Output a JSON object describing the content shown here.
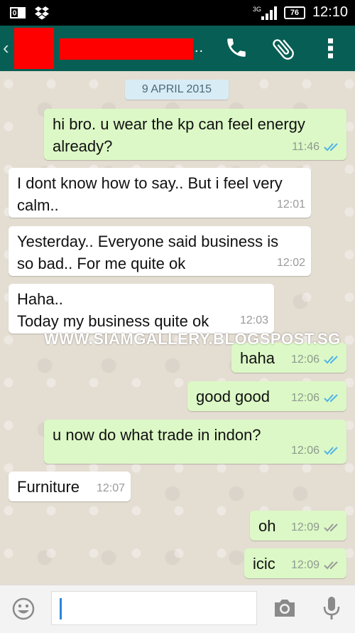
{
  "status_bar": {
    "time": "12:10",
    "battery": "76",
    "network": "3G",
    "left_icons": [
      "outlook-icon",
      "dropbox-icon"
    ]
  },
  "app_bar": {
    "icons": [
      "back-arrow-icon",
      "phone-icon",
      "paperclip-icon",
      "more-vert-icon"
    ],
    "ellipsis": "..",
    "brand_color": "#075e54"
  },
  "chat": {
    "date": "9 APRIL 2015",
    "messages": [
      {
        "dir": "out",
        "text": "hi bro. u wear the kp can feel energy\nalready?",
        "time": "11:46",
        "status": "read"
      },
      {
        "dir": "in",
        "text": "I dont know how to say.. But i feel very\ncalm..",
        "time": "12:01"
      },
      {
        "dir": "in",
        "text": "Yesterday.. Everyone said business is\nso bad.. For me quite ok",
        "time": "12:02"
      },
      {
        "dir": "in",
        "text": "Haha..\nToday my business quite ok",
        "time": "12:03"
      },
      {
        "dir": "out",
        "text": "haha",
        "time": "12:06",
        "status": "read"
      },
      {
        "dir": "out",
        "text": "good good",
        "time": "12:06",
        "status": "read"
      },
      {
        "dir": "out",
        "text": "u now do what trade in indon?",
        "time": "12:06",
        "status": "read"
      },
      {
        "dir": "in",
        "text": "Furniture",
        "time": "12:07"
      },
      {
        "dir": "out",
        "text": "oh",
        "time": "12:09",
        "status": "delivered"
      },
      {
        "dir": "out",
        "text": "icic",
        "time": "12:09",
        "status": "delivered"
      }
    ],
    "watermark": "WWW.SIAMGALLERY.BLOGSPOST.SG"
  },
  "input_bar": {
    "value": "",
    "icons": [
      "emoji-icon",
      "camera-icon",
      "microphone-icon"
    ]
  },
  "colors": {
    "outgoing_bubble": "#dcf8c6",
    "incoming_bubble": "#ffffff",
    "read_tick": "#4fb3e8",
    "delivered_tick": "#999999"
  }
}
